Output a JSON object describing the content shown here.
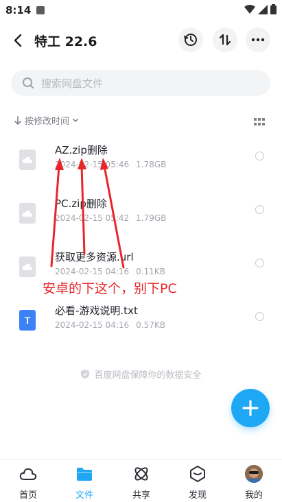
{
  "status_bar": {
    "time": "8:14"
  },
  "header": {
    "title": "特工 22.6"
  },
  "search": {
    "placeholder": "搜索网盘文件"
  },
  "sort": {
    "label": "按修改时间"
  },
  "files": [
    {
      "name": "AZ.zip删除",
      "date": "2024-02-15 05:46",
      "size": "1.78GB",
      "icon": "cloud-file-icon"
    },
    {
      "name": "PC.zip删除",
      "date": "2024-02-15 05:42",
      "size": "1.79GB",
      "icon": "cloud-file-icon"
    },
    {
      "name": "获取更多资源.url",
      "date": "2024-02-15 04:16",
      "size": "0.11KB",
      "icon": "cloud-file-icon"
    },
    {
      "name": "必看-游戏说明.txt",
      "date": "2024-02-15 04:16",
      "size": "0.57KB",
      "icon": "text-file-icon"
    }
  ],
  "annotation": {
    "text": "安卓的下这个，别下PC"
  },
  "footer": {
    "safety_note": "百度网盘保障你的数据安全"
  },
  "nav": [
    {
      "label": "首页",
      "icon": "cloud-icon",
      "active": false
    },
    {
      "label": "文件",
      "icon": "folder-icon",
      "active": true
    },
    {
      "label": "共享",
      "icon": "share-icon",
      "active": false
    },
    {
      "label": "发现",
      "icon": "discover-icon",
      "active": false
    },
    {
      "label": "我的",
      "icon": "avatar",
      "active": false
    }
  ],
  "colors": {
    "accent": "#1ea7f4",
    "annotation": "#e8262a",
    "text_file": "#3b82f6"
  }
}
